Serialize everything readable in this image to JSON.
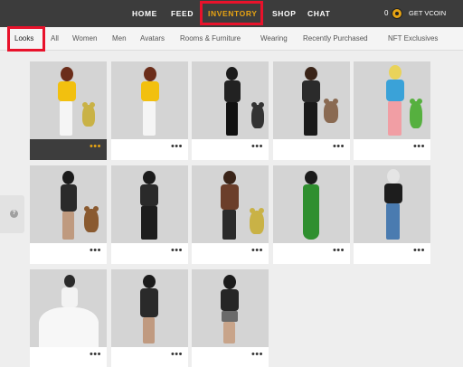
{
  "nav": {
    "items": [
      "HOME",
      "FEED",
      "INVENTORY",
      "SHOP",
      "CHAT"
    ],
    "active": "INVENTORY",
    "vcoin_count": "0",
    "get_vcoin": "GET VCOIN"
  },
  "tabs": {
    "items": [
      "Looks",
      "All",
      "Women",
      "Men",
      "Avatars",
      "Rooms & Furniture",
      "Wearing",
      "Recently Purchased",
      "NFT Exclusives"
    ],
    "active": "Looks"
  },
  "help": {
    "label": "?"
  },
  "cards": [
    {
      "more": "•••",
      "selected": true
    },
    {
      "more": "•••"
    },
    {
      "more": "•••"
    },
    {
      "more": "•••"
    },
    {
      "more": "•••"
    },
    {
      "more": "•••"
    },
    {
      "more": "•••"
    },
    {
      "more": "•••"
    },
    {
      "more": "•••"
    },
    {
      "more": "•••"
    },
    {
      "more": "•••"
    },
    {
      "more": "•••"
    },
    {
      "more": "•••"
    }
  ],
  "colors": {
    "accent": "#e6a313",
    "highlight": "#e8122b",
    "topbar": "#3c3c3c"
  }
}
